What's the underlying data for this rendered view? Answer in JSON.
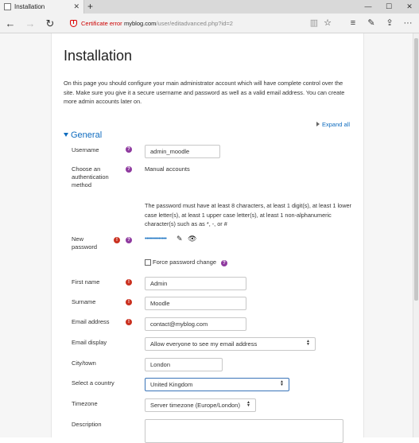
{
  "browser": {
    "tab_title": "Installation",
    "tab_close": "✕",
    "new_tab": "+",
    "window_controls": {
      "minimize": "—",
      "maximize": "☐",
      "close": "✕"
    },
    "nav": {
      "back": "←",
      "forward": "→",
      "refresh": "↻"
    },
    "cert_error": "Certificate error",
    "url_host": "myblog.com",
    "url_path": "/user/editadvanced.php?id=2",
    "icons": {
      "reading": "▥",
      "favorite": "☆",
      "hub": "≡",
      "notes": "✎",
      "share": "⇪",
      "more": "···"
    }
  },
  "page": {
    "title": "Installation",
    "intro": "On this page you should configure your main administrator account which will have complete control over the site. Make sure you give it a secure username and password as well as a valid email address. You can create more admin accounts later on.",
    "expand_all": "Expand all",
    "section": "General",
    "fields": {
      "username": {
        "label": "Username",
        "value": "admin_moodle"
      },
      "auth": {
        "label": "Choose an authentication method",
        "value": "Manual accounts"
      },
      "password_info": "The password must have at least 8 characters, at least 1 digit(s), at least 1 lower case letter(s), at least 1 upper case letter(s), at least 1 non-alphanumeric character(s) such as as *, -, or #",
      "password": {
        "label": "New password",
        "value": "••••••••••••••"
      },
      "force_change": {
        "label": "Force password change"
      },
      "firstname": {
        "label": "First name",
        "value": "Admin"
      },
      "surname": {
        "label": "Surname",
        "value": "Moodle"
      },
      "email": {
        "label": "Email address",
        "value": "contact@myblog.com"
      },
      "email_display": {
        "label": "Email display",
        "value": "Allow everyone to see my email address"
      },
      "city": {
        "label": "City/town",
        "value": "London"
      },
      "country": {
        "label": "Select a country",
        "value": "United Kingdom"
      },
      "timezone": {
        "label": "Timezone",
        "value": "Server timezone (Europe/London)"
      },
      "description": {
        "label": "Description"
      }
    },
    "help_glyph": "?",
    "required_glyph": "!",
    "select_arrow": "▲▼"
  },
  "colors": {
    "link": "#0f6cbf",
    "help": "#8f3a9f",
    "required": "#ca3120",
    "cert_error": "#cc0000"
  }
}
